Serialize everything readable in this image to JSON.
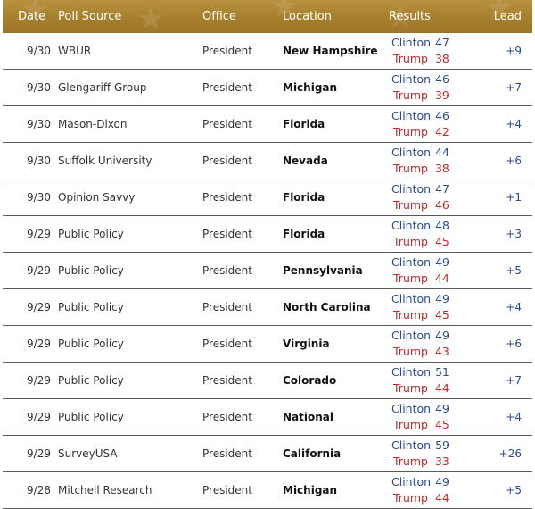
{
  "table": {
    "columns": [
      "Date",
      "Poll Source",
      "Office",
      "Location",
      "Results",
      "Lead"
    ],
    "rows": [
      {
        "date": "9/30",
        "source": "WBUR",
        "office": "President",
        "location": "New Hampshire",
        "c_name": "Clinton",
        "c_val": "47",
        "t_name": "Trump",
        "t_val": "38",
        "lead": "+9"
      },
      {
        "date": "9/30",
        "source": "Glengariff Group",
        "office": "President",
        "location": "Michigan",
        "c_name": "Clinton",
        "c_val": "46",
        "t_name": "Trump",
        "t_val": "39",
        "lead": "+7"
      },
      {
        "date": "9/30",
        "source": "Mason-Dixon",
        "office": "President",
        "location": "Florida",
        "c_name": "Clinton",
        "c_val": "46",
        "t_name": "Trump",
        "t_val": "42",
        "lead": "+4"
      },
      {
        "date": "9/30",
        "source": "Suffolk University",
        "office": "President",
        "location": "Nevada",
        "c_name": "Clinton",
        "c_val": "44",
        "t_name": "Trump",
        "t_val": "38",
        "lead": "+6"
      },
      {
        "date": "9/30",
        "source": "Opinion Savvy",
        "office": "President",
        "location": "Florida",
        "c_name": "Clinton",
        "c_val": "47",
        "t_name": "Trump",
        "t_val": "46",
        "lead": "+1"
      },
      {
        "date": "9/29",
        "source": "Public Policy",
        "office": "President",
        "location": "Florida",
        "c_name": "Clinton",
        "c_val": "48",
        "t_name": "Trump",
        "t_val": "45",
        "lead": "+3"
      },
      {
        "date": "9/29",
        "source": "Public Policy",
        "office": "President",
        "location": "Pennsylvania",
        "c_name": "Clinton",
        "c_val": "49",
        "t_name": "Trump",
        "t_val": "44",
        "lead": "+5"
      },
      {
        "date": "9/29",
        "source": "Public Policy",
        "office": "President",
        "location": "North Carolina",
        "c_name": "Clinton",
        "c_val": "49",
        "t_name": "Trump",
        "t_val": "45",
        "lead": "+4"
      },
      {
        "date": "9/29",
        "source": "Public Policy",
        "office": "President",
        "location": "Virginia",
        "c_name": "Clinton",
        "c_val": "49",
        "t_name": "Trump",
        "t_val": "43",
        "lead": "+6"
      },
      {
        "date": "9/29",
        "source": "Public Policy",
        "office": "President",
        "location": "Colorado",
        "c_name": "Clinton",
        "c_val": "51",
        "t_name": "Trump",
        "t_val": "44",
        "lead": "+7"
      },
      {
        "date": "9/29",
        "source": "Public Policy",
        "office": "President",
        "location": "National",
        "c_name": "Clinton",
        "c_val": "49",
        "t_name": "Trump",
        "t_val": "45",
        "lead": "+4"
      },
      {
        "date": "9/29",
        "source": "SurveyUSA",
        "office": "President",
        "location": "California",
        "c_name": "Clinton",
        "c_val": "59",
        "t_name": "Trump",
        "t_val": "33",
        "lead": "+26"
      },
      {
        "date": "9/28",
        "source": "Mitchell Research",
        "office": "President",
        "location": "Michigan",
        "c_name": "Clinton",
        "c_val": "49",
        "t_name": "Trump",
        "t_val": "44",
        "lead": "+5"
      }
    ]
  },
  "colors": {
    "header_gold": "#a9822f",
    "clinton_blue": "#2a4a8f",
    "trump_red": "#c4282b"
  }
}
